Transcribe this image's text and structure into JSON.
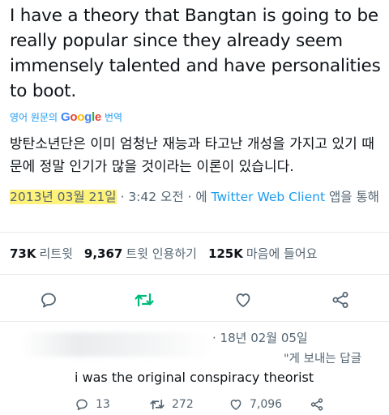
{
  "tweet": {
    "text": "I have a theory that Bangtan is going to be really popular since they already seem immensely talented and have personalities to boot."
  },
  "translation": {
    "label_prefix": "영어 원문의",
    "google": [
      "G",
      "o",
      "o",
      "g",
      "l",
      "e"
    ],
    "label_suffix": "번역",
    "text": "방탄소년단은 이미 엄청난 재능과 타고난 개성을 가지고 있기 때문에 정말 인기가 많을 것이라는 이론이 있습니다."
  },
  "meta": {
    "date": "2013년 03월 21일",
    "time": "· 3:42 오전 · 에",
    "client": "Twitter Web Client",
    "suffix": "앱을 통해"
  },
  "stats": {
    "retweets_count": "73K",
    "retweets_label": "리트윗",
    "quotes_count": "9,367",
    "quotes_label": "트윗 인용하기",
    "likes_count": "125K",
    "likes_label": "마음에 들어요"
  },
  "reply": {
    "date": "· 18년 02월 05일",
    "replying_to": "\"게 보내는 답글",
    "text": "i was the original conspiracy theorist",
    "reply_count": "13",
    "retweet_count": "272",
    "like_count": "7,096"
  },
  "colors": {
    "accent": "#1d9bf0",
    "retweet_green": "#00ba7c",
    "muted": "#536471",
    "highlight": "#fff27a"
  }
}
